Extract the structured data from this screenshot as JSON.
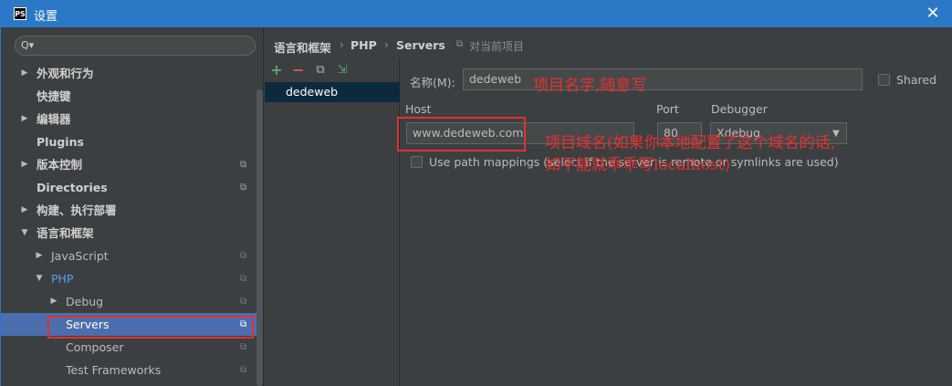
{
  "window": {
    "title": "设置",
    "app_icon": "PS",
    "close_glyph": "✕"
  },
  "search": {
    "icon": "Q▾",
    "placeholder": ""
  },
  "sidebar": {
    "items": [
      {
        "label": "外观和行为",
        "arrow": "▶",
        "bold": true
      },
      {
        "label": "快捷键",
        "bold": true
      },
      {
        "label": "编辑器",
        "arrow": "▶",
        "bold": true
      },
      {
        "label": "Plugins",
        "bold": true
      },
      {
        "label": "版本控制",
        "arrow": "▶",
        "bold": true,
        "copy": true
      },
      {
        "label": "Directories",
        "bold": true,
        "copy": true
      },
      {
        "label": "构建、执行部署",
        "arrow": "▶",
        "bold": true
      },
      {
        "label": "语言和框架",
        "arrow": "▼",
        "bold": true
      },
      {
        "label": "JavaScript",
        "arrow": "▶",
        "copy": true
      },
      {
        "label": "PHP",
        "arrow": "▼",
        "copy": true
      },
      {
        "label": "Debug",
        "arrow": "▶",
        "copy": true
      },
      {
        "label": "Servers",
        "copy": true,
        "selected": true
      },
      {
        "label": "Composer",
        "copy": true
      },
      {
        "label": "Test Frameworks",
        "copy": true
      }
    ],
    "copy_glyph": "⧉"
  },
  "breadcrumb": {
    "items": [
      "语言和框架",
      "PHP",
      "Servers"
    ],
    "separator": "›",
    "note": "对当前项目",
    "note_icon": "⧉"
  },
  "toolbar": {
    "add": "+",
    "remove": "−",
    "copy": "⧉",
    "import": "⇲"
  },
  "servers": {
    "items": [
      "dedeweb"
    ]
  },
  "form": {
    "name_label": "名称(M):",
    "name_value": "dedeweb",
    "shared_label": "Shared",
    "host_label": "Host",
    "host_value": "www.dedeweb.com",
    "port_label": "Port",
    "port_value": "80",
    "debugger_label": "Debugger",
    "debugger_value": "Xdebug",
    "path_mappings_label": "Use path mappings (select if the server is remote or symlinks are used)"
  },
  "annotations": {
    "name_note": "项目名字,随意写",
    "host_note_line1": "项目域名(如果你本地配置了这个域名的话,",
    "host_note_line2": "如不能就乖乖写localhost)"
  },
  "colors": {
    "titlebar": "#2b78c6",
    "selection": "#4b6eaf",
    "annotation_red": "#e8302e",
    "background": "#3c3f41"
  }
}
